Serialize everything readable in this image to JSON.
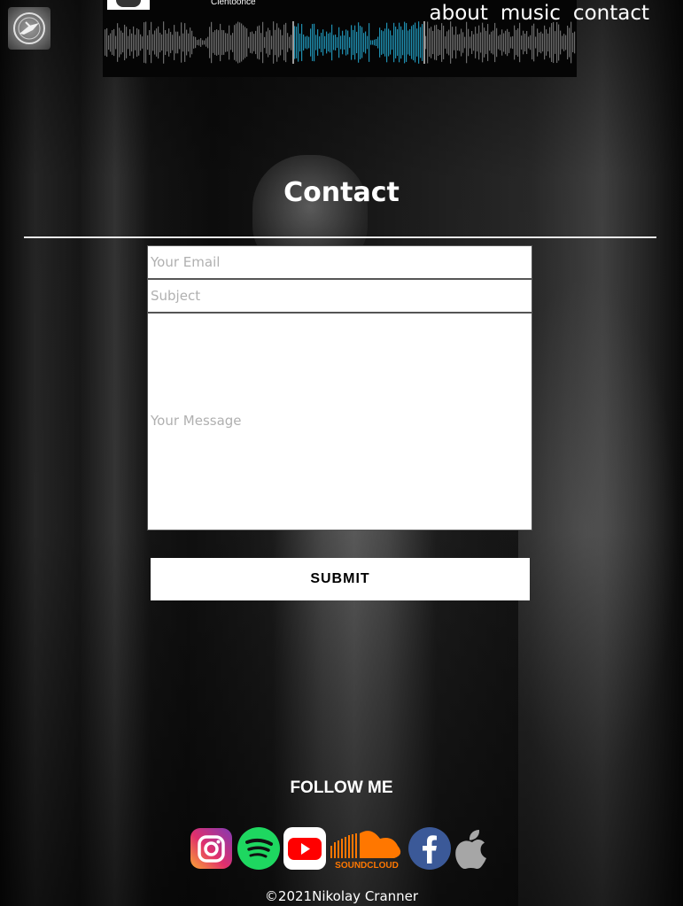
{
  "player": {
    "track_title": "Clentoonce"
  },
  "nav": {
    "about": "about",
    "music": "music",
    "contact": "contact"
  },
  "contact": {
    "title": "Contact",
    "email_placeholder": "Your Email",
    "subject_placeholder": "Subject",
    "message_placeholder": "Your Message",
    "submit_label": "SUBMIT"
  },
  "follow": {
    "title": "FOLLOW ME",
    "networks": [
      "instagram-icon",
      "spotify-icon",
      "youtube-icon",
      "soundcloud-icon",
      "facebook-icon",
      "apple-icon"
    ],
    "soundcloud_label": "SOUNDCLOUD"
  },
  "footer": {
    "copyright": "©2021Nikolay Cranner"
  },
  "colors": {
    "waveform_played": "#1f8fb0",
    "waveform_unplayed": "#6b6b6b",
    "background": "#000000"
  }
}
